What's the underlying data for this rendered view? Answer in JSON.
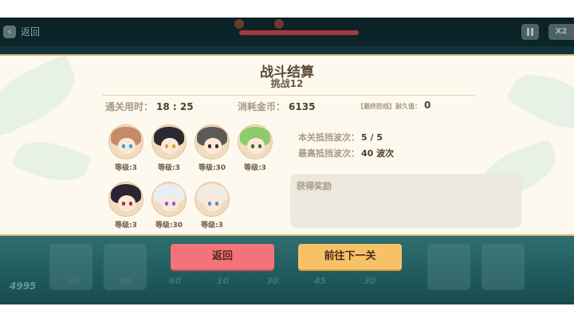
{
  "topbar": {
    "back_label": "返回",
    "back_icon": "chevron-left-icon",
    "speed_label": "X2",
    "pause_icon": "pause-icon"
  },
  "background": {
    "gold_total": "4995",
    "slot_costs": [
      "25",
      "90",
      "60",
      "10",
      "30",
      "45",
      "30"
    ]
  },
  "result": {
    "title": "战斗结算",
    "subtitle": "挑战12",
    "clear_time_label": "通关用时：",
    "clear_time_value": "18 : 25",
    "gold_spent_label": "消耗金币：",
    "gold_spent_value": "6135",
    "defense_label": "【最终防线】耐久值：",
    "defense_value": "0",
    "waves_blocked_label": "本关抵挡波次：",
    "waves_blocked_value": "5 / 5",
    "best_waves_label": "最高抵挡波次：",
    "best_waves_value": "40 波次",
    "reward_title": "获得奖励"
  },
  "heroes": [
    {
      "level": "等级:3",
      "hair": "#c48b6a",
      "eye": "#3aa3c9"
    },
    {
      "level": "等级:3",
      "hair": "#2b2a33",
      "eye": "#e0a13a"
    },
    {
      "level": "等级:30",
      "hair": "#5c5a57",
      "eye": "#333333"
    },
    {
      "level": "等级:3",
      "hair": "#8ecb6a",
      "eye": "#3b6b3b"
    },
    {
      "level": "等级:3",
      "hair": "#2a2530",
      "eye": "#b03030"
    },
    {
      "level": "等级:30",
      "hair": "#e8eef5",
      "eye": "#7a67d6"
    },
    {
      "level": "等级:3",
      "hair": "#f0ece4",
      "eye": "#5a8ed0"
    }
  ],
  "buttons": {
    "back": "返回",
    "next": "前往下一关"
  },
  "colors": {
    "panel_bg": "#fdf9ee",
    "back_button": "#f4727a",
    "next_button": "#f7c267",
    "game_bg": "#12424a"
  }
}
